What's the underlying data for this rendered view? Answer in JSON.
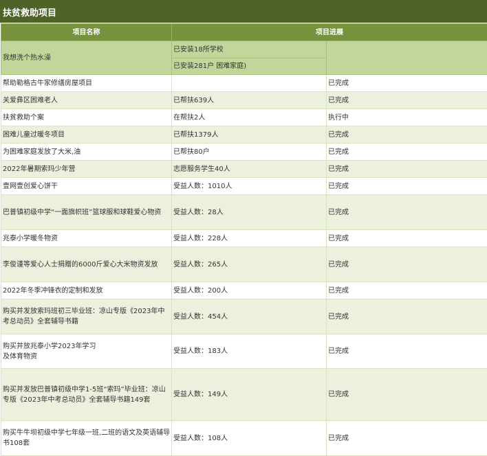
{
  "title": "扶贫救助项目",
  "headers": {
    "name": "项目名称",
    "progress": "项目进展"
  },
  "first_row": {
    "name": "我想洗个热水澡",
    "progress_1": "已安装18所学校",
    "progress_2": "已安装281户 困难家庭)",
    "status": ""
  },
  "rows": [
    {
      "name": "帮助勒格古牛家修缮房屋项目",
      "progress": "",
      "status": "已完成"
    },
    {
      "name": "关爱彝区困难老人",
      "progress": "已帮扶639人",
      "status": "已完成"
    },
    {
      "name": "扶贫救助个案",
      "progress": "在帮扶2人",
      "status": "执行中"
    },
    {
      "name": "困难儿童过暖冬项目",
      "progress": "已帮扶1379人",
      "status": "已完成"
    },
    {
      "name": "为困难家庭发放了大米,油",
      "progress": "已帮扶80户",
      "status": "已完成"
    },
    {
      "name": "2022年暑期索玛少年营",
      "progress": "志愿服务学生40人",
      "status": "已完成"
    },
    {
      "name": "壹网壹创爱心饼干",
      "progress": "受益人数：1010人",
      "status": "已完成"
    },
    {
      "name": "巴普镇初级中学“一面旗帜班”篮球服和球鞋爱心物资",
      "progress": "受益人数：28人",
      "status": "已完成"
    },
    {
      "name": "兆泰小学暖冬物资",
      "progress": "受益人数：228人",
      "status": "已完成"
    },
    {
      "name": "李俊谨等爱心人士捐赠的6000斤爱心大米物资发放",
      "progress": "受益人数：265人",
      "status": "已完成"
    },
    {
      "name": "2022年冬季冲锋衣的定制和发放",
      "progress": "受益人数：200人",
      "status": "已完成"
    },
    {
      "name": "购买并发放索玛班初三毕业班：凉山专版《2023年中考总动员》全套辅导书籍",
      "progress": "受益人数：454人",
      "status": "已完成"
    },
    {
      "name": "购买并放兆泰小学2023年学习\n及体育物资",
      "progress": "受益人数：183人",
      "status": "已完成"
    },
    {
      "name": "购买并发放巴普镇初级中学1-5班“索玛”毕业班：凉山专版《2023年中考总动员》全套辅导书籍149套",
      "progress": "受益人数：149人",
      "status": "已完成"
    },
    {
      "name": "购买牛牛坝初级中学七年级一班,二班的语文及英语辅导书108套",
      "progress": "受益人数：108人",
      "status": "已完成"
    }
  ]
}
